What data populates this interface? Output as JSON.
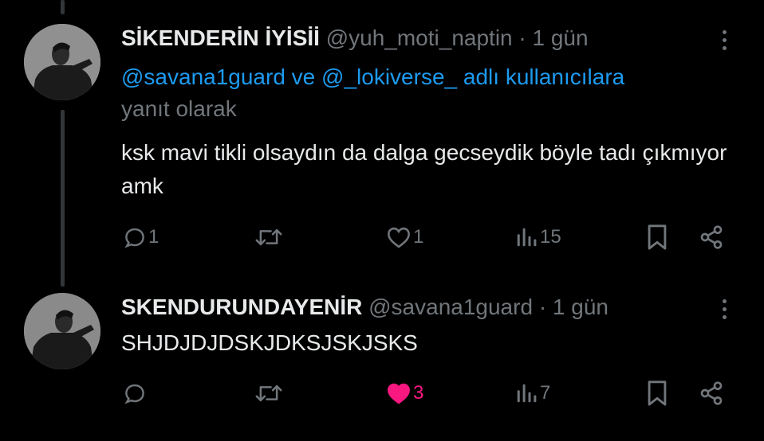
{
  "tweets": [
    {
      "display_name": "SİKENDERİN İYİSİİ",
      "handle": "@yuh_moti_naptin",
      "time": "· 1 gün",
      "reply_links": [
        "@savana1guard",
        "@_lokiverse_"
      ],
      "reply_and": " ve ",
      "reply_suffix": " adlı kullanıcılara",
      "reply_second_line": "yanıt olarak",
      "text": "ksk mavi tikli olsaydın da dalga gecseydik böyle tadı çıkmıyor amk",
      "replies": "1",
      "reposts": "",
      "likes": "1",
      "liked": false,
      "views": "15"
    },
    {
      "display_name": "SKENDURUNDAYENİR",
      "handle": "@savana1guard",
      "time": "· 1 gün",
      "text": "SHJDJDJDSKJDKSJSKJSKS",
      "replies": "",
      "reposts": "",
      "likes": "3",
      "liked": true,
      "views": "7"
    }
  ],
  "colors": {
    "background": "#000000",
    "text": "#e7e9ea",
    "secondary": "#71767b",
    "link": "#1d9bf0",
    "like": "#f91880",
    "thread_line": "#333639"
  },
  "icons": [
    "reply-icon",
    "repost-icon",
    "like-icon",
    "views-icon",
    "bookmark-icon",
    "share-icon",
    "more-icon"
  ]
}
